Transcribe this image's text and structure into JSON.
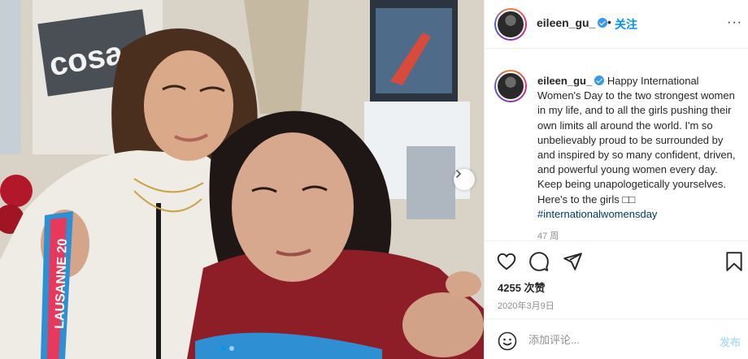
{
  "photo": {
    "medal_ribbon_text": "LAUSANNE 20",
    "poster_text": "cosa",
    "carousel_total": 2,
    "carousel_active_index": 1
  },
  "header": {
    "username": "eileen_gu_",
    "separator": "•",
    "follow_label": "关注",
    "more_label": "···"
  },
  "caption": {
    "username": "eileen_gu_",
    "body": "Happy International Women's Day to the two strongest women in my life, and to all the girls pushing their own limits all around the world. I'm so unbelievably proud to be surrounded by and inspired by so many confident, driven, and powerful young women every day. Keep being unapologetically yourselves. Here's to the girls □□ ",
    "hashtag": "#internationalwomensday",
    "time_ago": "47 周"
  },
  "actions": {
    "like_icon": "heart-icon",
    "comment_icon": "comment-icon",
    "share_icon": "paper-plane-icon",
    "save_icon": "bookmark-icon"
  },
  "stats": {
    "likes": "4255 次赞",
    "date": "2020年3月9日"
  },
  "comment_box": {
    "placeholder": "添加评论...",
    "post_label": "发布"
  },
  "colors": {
    "accent": "#0095f6",
    "verified": "#3897f0",
    "post_disabled": "#b2dffc",
    "border": "#efefef"
  }
}
